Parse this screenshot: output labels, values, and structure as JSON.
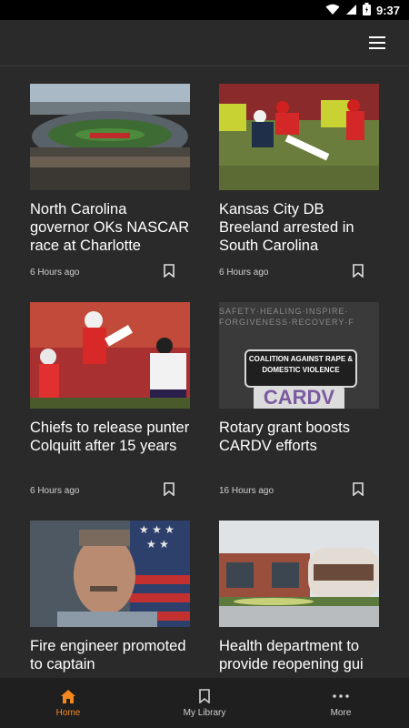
{
  "status_bar": {
    "time": "9:37"
  },
  "articles": [
    {
      "title": "North Carolina governor OKs NASCAR race at Charlotte",
      "age": "6 Hours ago",
      "image": "speedway-aerial-photo"
    },
    {
      "title": "Kansas City DB Breeland arrested in South Carolina",
      "age": "6 Hours ago",
      "image": "football-game-photo"
    },
    {
      "title": "Chiefs to release punter Colquitt after 15 years",
      "age": "6 Hours ago",
      "image": "punter-kick-photo"
    },
    {
      "title": "Rotary grant boosts CARDV efforts",
      "age": "16 Hours ago",
      "image": "cardv-sign-photo",
      "image_text": {
        "banner": "COALITION AGAINST RAPE & DOMESTIC VIOLENCE",
        "logo": "CARDV",
        "words": "SAFETY·HEALING·INSPIRE· FORGIVENESS·RECOVERY·F"
      }
    },
    {
      "title": "Fire engineer promoted to captain",
      "age": "",
      "image": "portrait-flag-photo"
    },
    {
      "title": "Health department to provide reopening gui",
      "age": "",
      "image": "building-photo"
    }
  ],
  "nav": {
    "home": "Home",
    "library": "My Library",
    "more": "More"
  },
  "colors": {
    "accent": "#f5871f",
    "background": "#2a2a2a",
    "nav_background": "#1f1f1f"
  }
}
